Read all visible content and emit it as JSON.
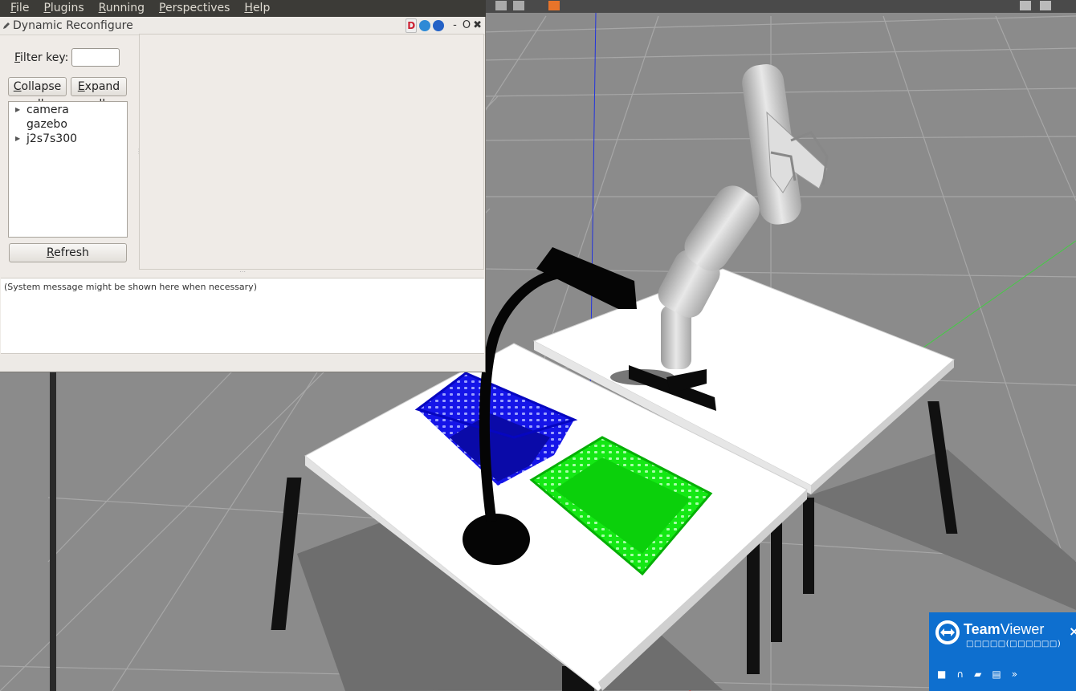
{
  "menubar": {
    "items": [
      {
        "u": "F",
        "rest": "ile"
      },
      {
        "u": "P",
        "rest": "lugins"
      },
      {
        "u": "R",
        "rest": "unning"
      },
      {
        "u": "P",
        "rest": "erspectives"
      },
      {
        "u": "H",
        "rest": "elp"
      }
    ]
  },
  "plugin": {
    "title": "Dynamic Reconfigure",
    "title_buttons": {
      "d": "D",
      "minimize": "-",
      "float": "O",
      "close": "✖"
    }
  },
  "filter": {
    "label_u": "F",
    "label_rest": "ilter key:",
    "value": ""
  },
  "buttons": {
    "collapse_u": "C",
    "collapse_rest": "ollapse all",
    "expand_u": "E",
    "expand_rest": "xpand all",
    "refresh_u": "R",
    "refresh_rest": "efresh"
  },
  "tree": {
    "nodes": [
      {
        "label": "camera",
        "expandable": true
      },
      {
        "label": "gazebo",
        "expandable": false
      },
      {
        "label": "j2s7s300",
        "expandable": true
      }
    ]
  },
  "message": "(System message might be shown here when necessary)",
  "teamviewer": {
    "brand_bold": "Team",
    "brand_rest": "Viewer",
    "subtitle": "□□□□□(□□□□□□)",
    "close": "×",
    "accent": "#0e6fcf"
  },
  "colors": {
    "menubar_bg": "#3c3b37",
    "window_bg": "#efebe7",
    "ground": "#8a8a8a",
    "basket_blue": "#1010e0",
    "basket_green": "#10e010"
  }
}
